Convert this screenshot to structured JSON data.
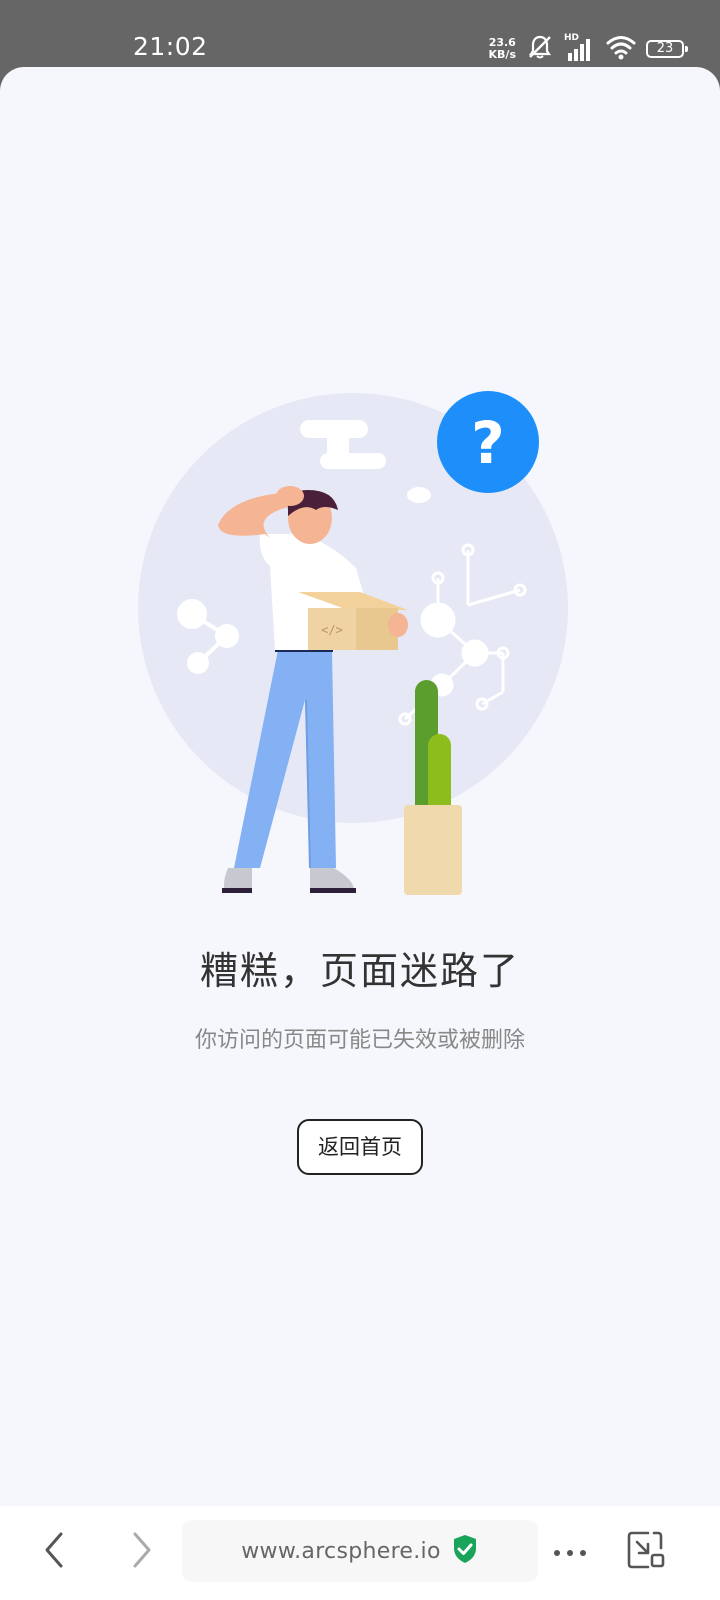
{
  "status_bar": {
    "time": "21:02",
    "net_speed_value": "23.6",
    "net_speed_unit": "KB/s",
    "signal_label": "HD",
    "battery_level": "23"
  },
  "error_page": {
    "headline": "糟糕，页面迷路了",
    "description": "你访问的页面可能已失效或被删除",
    "home_button_label": "返回首页",
    "illustration_mark": "?",
    "box_code_mark": "</>"
  },
  "browser_bar": {
    "url": "www.arcsphere.io",
    "back_icon": "chevron-left-icon",
    "forward_icon": "chevron-right-icon",
    "secure_icon": "shield-check-icon",
    "menu_icon": "more-horizontal-icon",
    "picture_in_picture_icon": "minimize-window-icon"
  },
  "colors": {
    "accent_blue": "#1e8ffa",
    "secure_green": "#1aa35a",
    "sheet_background": "#f5f7fc",
    "status_bar_background": "#666666"
  }
}
